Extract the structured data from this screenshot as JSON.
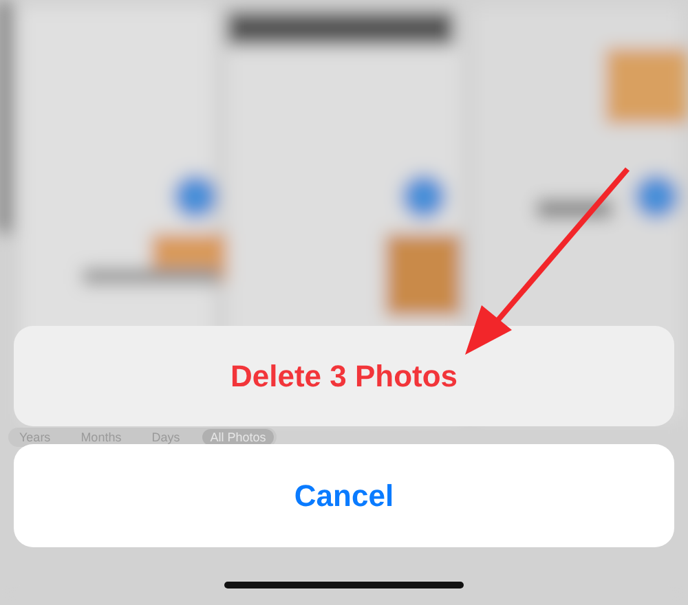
{
  "view_tabs": [
    {
      "label": "Years",
      "selected": false
    },
    {
      "label": "Months",
      "selected": false
    },
    {
      "label": "Days",
      "selected": false
    },
    {
      "label": "All Photos",
      "selected": true
    }
  ],
  "action_sheet": {
    "actions": [
      {
        "label": "Delete 3 Photos",
        "kind": "destructive"
      }
    ],
    "cancel": "Cancel"
  },
  "annotation": {
    "kind": "arrow"
  }
}
